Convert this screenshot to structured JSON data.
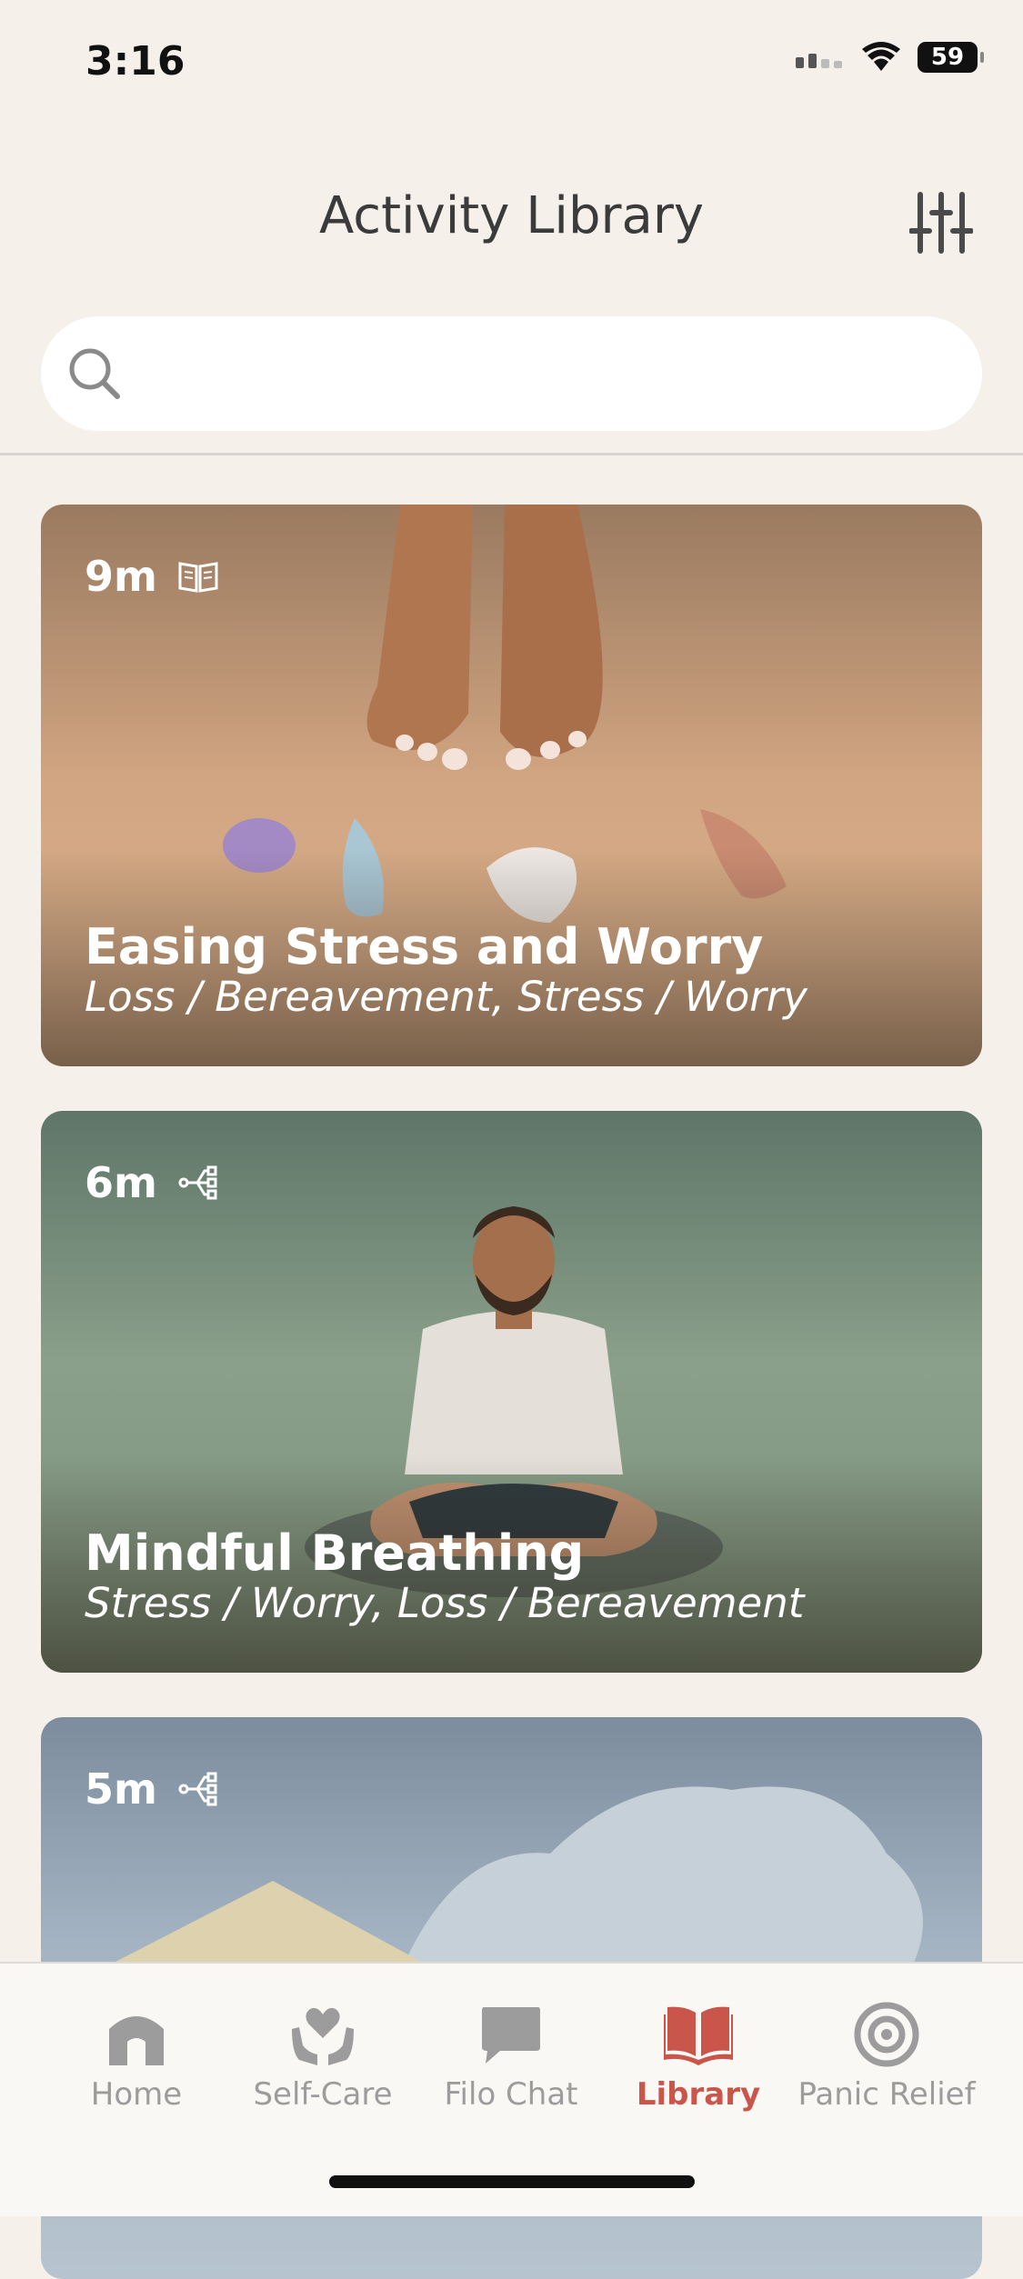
{
  "status_bar": {
    "time": "3:16",
    "battery": "59"
  },
  "header": {
    "title": "Activity Library"
  },
  "search": {
    "placeholder": "",
    "value": ""
  },
  "cards": [
    {
      "duration": "9m",
      "type_icon": "book-icon",
      "title": "Easing Stress and Worry",
      "tags": "Loss / Bereavement, Stress / Worry"
    },
    {
      "duration": "6m",
      "type_icon": "branch-icon",
      "title": "Mindful Breathing",
      "tags": "Stress / Worry, Loss / Bereavement"
    },
    {
      "duration": "5m",
      "type_icon": "branch-icon",
      "title": "",
      "tags": ""
    }
  ],
  "tabs": [
    {
      "label": "Home",
      "icon": "house-icon",
      "active": false
    },
    {
      "label": "Self-Care",
      "icon": "heart-hands-icon",
      "active": false
    },
    {
      "label": "Filo Chat",
      "icon": "chat-bubble-icon",
      "active": false
    },
    {
      "label": "Library",
      "icon": "open-book-icon",
      "active": true
    },
    {
      "label": "Panic Relief",
      "icon": "target-icon",
      "active": false
    }
  ],
  "colors": {
    "background": "#f5f0ea",
    "accent": "#c9554b",
    "tab_inactive": "#9c9c9c"
  }
}
